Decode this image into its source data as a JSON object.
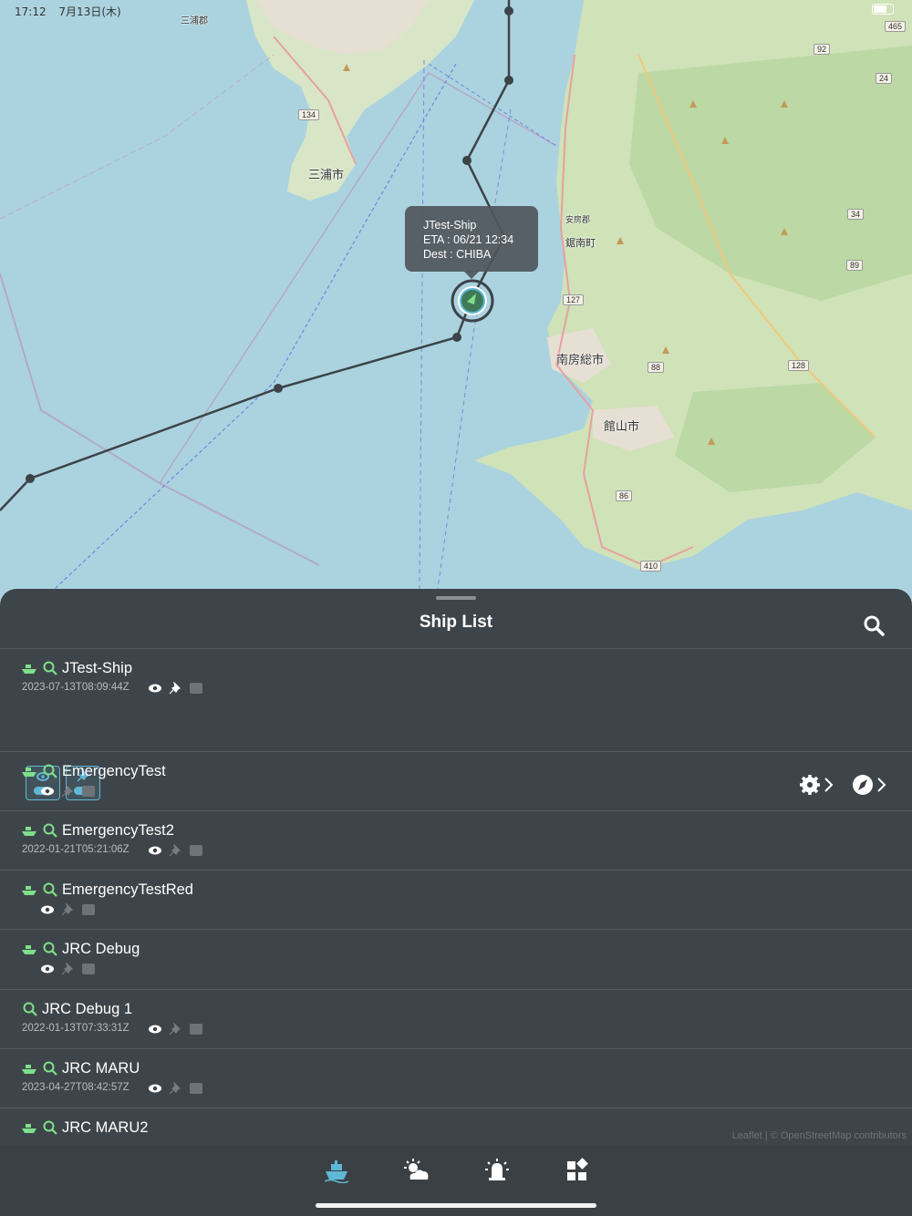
{
  "status_bar": {
    "time": "17:12",
    "date": "7月13日(木)"
  },
  "map": {
    "popup": {
      "name": "JTest-Ship",
      "eta": "ETA : 06/21 12:34",
      "dest": "Dest : CHIBA"
    },
    "cities": {
      "miura": "三浦市",
      "kyonan": "鋸南町",
      "minamiboso": "南房総市",
      "tateyama": "館山市",
      "miura_top": "三浦郡",
      "awa": "安房郡"
    },
    "roads": {
      "r134": "134",
      "r127": "127",
      "r88": "88",
      "r128": "128",
      "r86": "86",
      "r410": "410",
      "r89": "89",
      "r34": "34",
      "r24a": "24",
      "r92": "92",
      "r465": "465"
    },
    "attribution": "Leaflet | © OpenStreetMap contributors"
  },
  "panel": {
    "title": "Ship List",
    "ships": [
      {
        "name": "JTest-Ship",
        "timestamp": "2023-07-13T08:09:44Z"
      },
      {
        "name": "EmergencyTest",
        "timestamp": ""
      },
      {
        "name": "EmergencyTest2",
        "timestamp": "2022-01-21T05:21:06Z"
      },
      {
        "name": "EmergencyTestRed",
        "timestamp": ""
      },
      {
        "name": "JRC Debug",
        "timestamp": ""
      },
      {
        "name": "JRC Debug 1",
        "timestamp": "2022-01-13T07:33:31Z"
      },
      {
        "name": "JRC MARU",
        "timestamp": "2023-04-27T08:42:57Z"
      },
      {
        "name": "JRC MARU2",
        "timestamp": ""
      }
    ]
  },
  "colors": {
    "accent": "#5fb8d6",
    "ship_green": "#7ee08a",
    "panel_bg": "#373c41"
  },
  "tabs": [
    "ship-icon",
    "weather-icon",
    "alarm-icon",
    "dashboard-icon"
  ]
}
